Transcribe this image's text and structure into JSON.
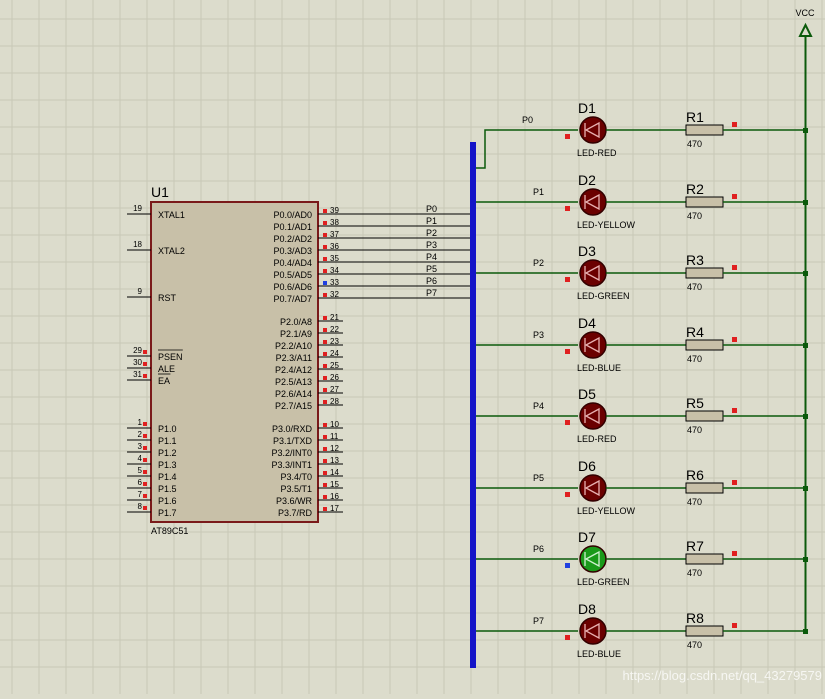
{
  "supply": {
    "label": "VCC"
  },
  "mcu": {
    "ref": "U1",
    "part": "AT89C51",
    "left_pins": [
      {
        "num": "19",
        "name": "XTAL1"
      },
      {
        "num": "18",
        "name": "XTAL2"
      },
      {
        "num": "9",
        "name": "RST"
      },
      {
        "num": "29",
        "name": "PSEN"
      },
      {
        "num": "30",
        "name": "ALE"
      },
      {
        "num": "31",
        "name": "EA"
      },
      {
        "num": "1",
        "name": "P1.0"
      },
      {
        "num": "2",
        "name": "P1.1"
      },
      {
        "num": "3",
        "name": "P1.2"
      },
      {
        "num": "4",
        "name": "P1.3"
      },
      {
        "num": "5",
        "name": "P1.4"
      },
      {
        "num": "6",
        "name": "P1.5"
      },
      {
        "num": "7",
        "name": "P1.6"
      },
      {
        "num": "8",
        "name": "P1.7"
      }
    ],
    "right_pins": [
      {
        "num": "39",
        "name": "P0.0/AD0"
      },
      {
        "num": "38",
        "name": "P0.1/AD1"
      },
      {
        "num": "37",
        "name": "P0.2/AD2"
      },
      {
        "num": "36",
        "name": "P0.3/AD3"
      },
      {
        "num": "35",
        "name": "P0.4/AD4"
      },
      {
        "num": "34",
        "name": "P0.5/AD5"
      },
      {
        "num": "33",
        "name": "P0.6/AD6"
      },
      {
        "num": "32",
        "name": "P0.7/AD7"
      },
      {
        "num": "21",
        "name": "P2.0/A8"
      },
      {
        "num": "22",
        "name": "P2.1/A9"
      },
      {
        "num": "23",
        "name": "P2.2/A10"
      },
      {
        "num": "24",
        "name": "P2.3/A11"
      },
      {
        "num": "25",
        "name": "P2.4/A12"
      },
      {
        "num": "26",
        "name": "P2.5/A13"
      },
      {
        "num": "27",
        "name": "P2.6/A14"
      },
      {
        "num": "28",
        "name": "P2.7/A15"
      },
      {
        "num": "10",
        "name": "P3.0/RXD"
      },
      {
        "num": "11",
        "name": "P3.1/TXD"
      },
      {
        "num": "12",
        "name": "P3.2/INT0"
      },
      {
        "num": "13",
        "name": "P3.3/INT1"
      },
      {
        "num": "14",
        "name": "P3.4/T0"
      },
      {
        "num": "15",
        "name": "P3.5/T1"
      },
      {
        "num": "16",
        "name": "P3.6/WR"
      },
      {
        "num": "17",
        "name": "P3.7/RD"
      }
    ]
  },
  "bus_labels": [
    "P0",
    "P1",
    "P2",
    "P3",
    "P4",
    "P5",
    "P6",
    "P7"
  ],
  "rows": [
    {
      "net": "P0",
      "led_ref": "D1",
      "led_type": "LED-RED",
      "res_ref": "R1",
      "res_value": "470",
      "lit": false
    },
    {
      "net": "P1",
      "led_ref": "D2",
      "led_type": "LED-YELLOW",
      "res_ref": "R2",
      "res_value": "470",
      "lit": false
    },
    {
      "net": "P2",
      "led_ref": "D3",
      "led_type": "LED-GREEN",
      "res_ref": "R3",
      "res_value": "470",
      "lit": false
    },
    {
      "net": "P3",
      "led_ref": "D4",
      "led_type": "LED-BLUE",
      "res_ref": "R4",
      "res_value": "470",
      "lit": false
    },
    {
      "net": "P4",
      "led_ref": "D5",
      "led_type": "LED-RED",
      "res_ref": "R5",
      "res_value": "470",
      "lit": false
    },
    {
      "net": "P5",
      "led_ref": "D6",
      "led_type": "LED-YELLOW",
      "res_ref": "R6",
      "res_value": "470",
      "lit": false
    },
    {
      "net": "P6",
      "led_ref": "D7",
      "led_type": "LED-GREEN",
      "res_ref": "R7",
      "res_value": "470",
      "lit": true
    },
    {
      "net": "P7",
      "led_ref": "D8",
      "led_type": "LED-BLUE",
      "res_ref": "R8",
      "res_value": "470",
      "lit": false
    }
  ],
  "watermark": "https://blog.csdn.net/qq_43279579",
  "colors": {
    "background": "#dcdccc",
    "grid": "#c8c8b6",
    "wire": "#0b5a0b",
    "bus": "#1414c8",
    "body_stroke": "#7a1a1a",
    "body_fill": "#c8c0a8",
    "led_off": "#6b0000",
    "led_on": "#1a9a1a",
    "pin_red": "#e02020",
    "pin_blue": "#2040e0"
  }
}
